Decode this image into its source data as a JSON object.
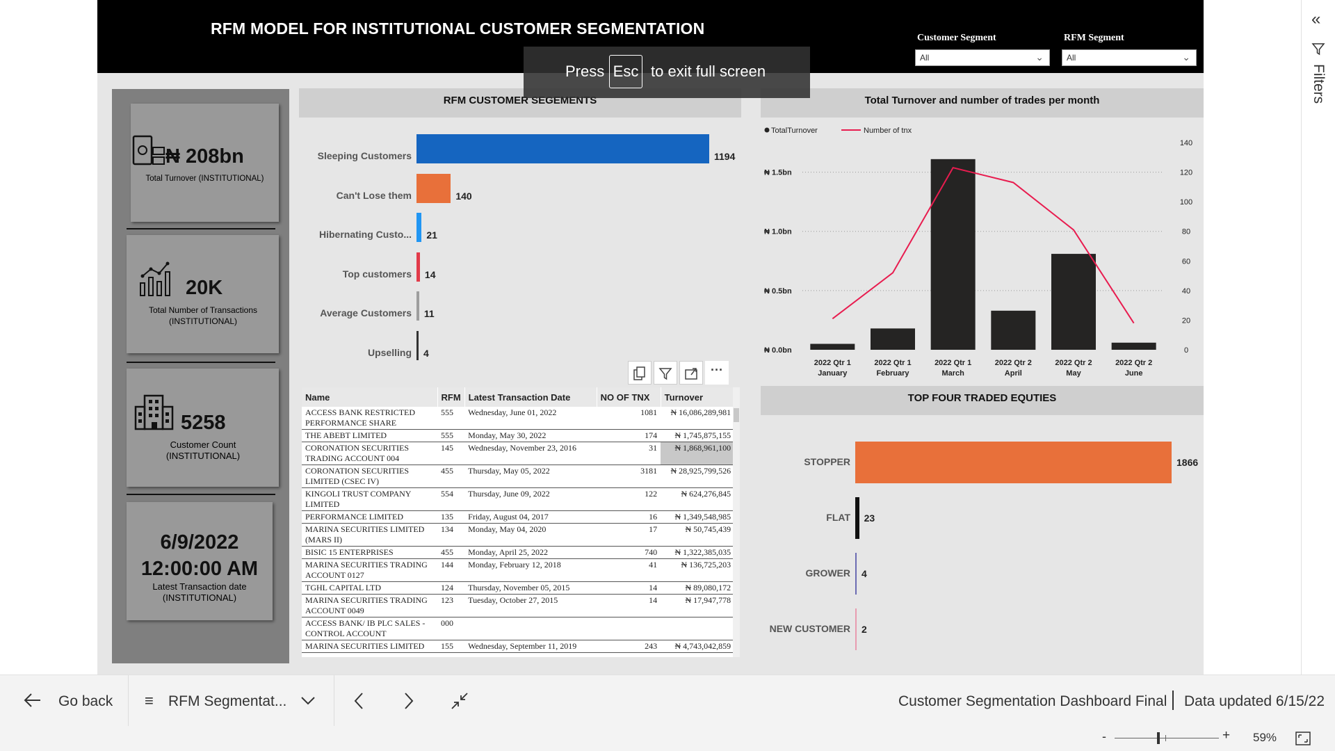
{
  "report": {
    "title": "RFM MODEL FOR INSTITUTIONAL CUSTOMER SEGMENTATION",
    "slicers": [
      {
        "label": "Customer Segment",
        "value": "All"
      },
      {
        "label": "RFM Segment",
        "value": "All"
      }
    ]
  },
  "fullscreen_toast": {
    "press": "Press",
    "key": "Esc",
    "rest": "to exit full screen"
  },
  "kpis": [
    {
      "value": "₦ 208bn",
      "label": "Total Turnover (INSTITUTIONAL)",
      "icon": "money-icon"
    },
    {
      "value": "20K",
      "label": "Total Number of Transactions (INSTITUTIONAL)",
      "icon": "bar-chart-icon"
    },
    {
      "value": "5258",
      "label": "Customer Count (INSTITUTIONAL)",
      "icon": "building-icon"
    },
    {
      "value": "6/9/2022 12:00:00 AM",
      "value_line1": "6/9/2022",
      "value_line2": "12:00:00 AM",
      "label": "Latest Transaction date (INSTITUTIONAL)"
    }
  ],
  "rfm_chart": {
    "title": "RFM CUSTOMER SEGEMENTS",
    "chart_data": {
      "type": "bar",
      "orientation": "horizontal",
      "categories": [
        "Sleeping Customers",
        "Can't Lose them",
        "Hibernating Custo...",
        "Top customers",
        "Average Customers",
        "Upselling"
      ],
      "values": [
        1194,
        140,
        21,
        14,
        11,
        4
      ],
      "colors": [
        "#1565c0",
        "#e8703a",
        "#2196f3",
        "#e23b4a",
        "#9e9e9e",
        "#333333"
      ]
    }
  },
  "table_tools": [
    "copy-icon",
    "filter-icon",
    "focus-mode-icon",
    "more-options-icon"
  ],
  "customer_table": {
    "columns": [
      "Name",
      "RFM",
      "Latest Transaction Date",
      "NO OF TNX",
      "Turnover"
    ],
    "rows": [
      [
        "ACCESS BANK RESTRICTED PERFORMANCE SHARE",
        "555",
        "Wednesday, June 01, 2022",
        "1081",
        "₦ 16,086,289,981"
      ],
      [
        "THE ABEBT LIMITED",
        "555",
        "Monday, May 30, 2022",
        "174",
        "₦ 1,745,875,155"
      ],
      [
        "CORONATION SECURITIES TRADING ACCOUNT 004",
        "145",
        "Wednesday, November 23, 2016",
        "31",
        "₦ 1,868,961,100"
      ],
      [
        "CORONATION SECURITIES LIMITED (CSEC IV)",
        "455",
        "Thursday, May 05, 2022",
        "3181",
        "₦ 28,925,799,526"
      ],
      [
        "KINGOLI TRUST COMPANY LIMITED",
        "554",
        "Thursday, June 09, 2022",
        "122",
        "₦ 624,276,845"
      ],
      [
        "PERFORMANCE LIMITED",
        "135",
        "Friday, August 04, 2017",
        "16",
        "₦ 1,349,548,985"
      ],
      [
        "MARINA SECURITIES LIMITED (MARS II)",
        "134",
        "Monday, May 04, 2020",
        "17",
        "₦ 50,745,439"
      ],
      [
        "BISIC 15 ENTERPRISES",
        "455",
        "Monday, April 25, 2022",
        "740",
        "₦ 1,322,385,035"
      ],
      [
        "MARINA SECURITIES TRADING ACCOUNT 0127",
        "144",
        "Monday, February 12, 2018",
        "41",
        "₦ 136,725,203"
      ],
      [
        "TGHL CAPITAL LTD",
        "124",
        "Thursday, November 05, 2015",
        "14",
        "₦ 89,080,172"
      ],
      [
        "MARINA SECURITIES TRADING ACCOUNT 0049",
        "123",
        "Tuesday, October 27, 2015",
        "14",
        "₦ 17,947,778"
      ],
      [
        "ACCESS BANK/ IB PLC SALES - CONTROL ACCOUNT",
        "000",
        "",
        "",
        ""
      ],
      [
        "MARINA SECURITIES LIMITED",
        "155",
        "Wednesday, September 11, 2019",
        "243",
        "₦ 4,743,042,859"
      ]
    ]
  },
  "combo_chart": {
    "title": "Total Turnover and number of trades per month",
    "chart_data": {
      "type": "bar",
      "categories": [
        "2022 Qtr 1 January",
        "2022 Qtr 1 February",
        "2022 Qtr 1 March",
        "2022 Qtr 2 April",
        "2022 Qtr 2 May",
        "2022 Qtr 2 June"
      ],
      "category_lines": [
        [
          "2022 Qtr 1",
          "January"
        ],
        [
          "2022 Qtr 1",
          "February"
        ],
        [
          "2022 Qtr 1",
          "March"
        ],
        [
          "2022 Qtr 2",
          "April"
        ],
        [
          "2022 Qtr 2",
          "May"
        ],
        [
          "2022 Qtr 2",
          "June"
        ]
      ],
      "series": [
        {
          "name": "TotalTurnover",
          "type": "bar",
          "axis": "left",
          "values": [
            0.05,
            0.18,
            1.61,
            0.33,
            0.81,
            0.06
          ],
          "color": "#252423"
        },
        {
          "name": "Number of tnx",
          "type": "line",
          "axis": "right",
          "values": [
            21,
            52,
            123,
            113,
            81,
            18
          ],
          "color": "#e81c4f"
        }
      ],
      "left_axis": {
        "ticks": [
          "₦ 0.0bn",
          "₦ 0.5bn",
          "₦ 1.0bn",
          "₦ 1.5bn"
        ],
        "tick_values": [
          0,
          0.5,
          1.0,
          1.5
        ],
        "range": [
          0,
          1.75
        ]
      },
      "right_axis": {
        "ticks": [
          "0",
          "20",
          "40",
          "60",
          "80",
          "100",
          "120",
          "140"
        ],
        "tick_values": [
          0,
          20,
          40,
          60,
          80,
          100,
          120,
          140
        ],
        "range": [
          0,
          140
        ]
      },
      "legend_position": "top-left",
      "grid": true
    }
  },
  "equities_chart": {
    "title": "TOP FOUR TRADED EQUTIES",
    "chart_data": {
      "type": "bar",
      "orientation": "horizontal",
      "categories": [
        "STOPPER",
        "FLAT",
        "GROWER",
        "NEW CUSTOMER"
      ],
      "values": [
        1866,
        23,
        4,
        2
      ],
      "colors": [
        "#e8703a",
        "#111111",
        "#6b6bb3",
        "#e89bb0"
      ]
    }
  },
  "bottom_bar": {
    "go_back": "Go back",
    "page_name": "RFM Segmentat...",
    "report_name": "Customer Segmentation Dashboard Final",
    "data_updated": "Data updated 6/15/22",
    "zoom": "59%",
    "zoom_level": 0.59
  },
  "filters_pane": {
    "label": "Filters"
  }
}
